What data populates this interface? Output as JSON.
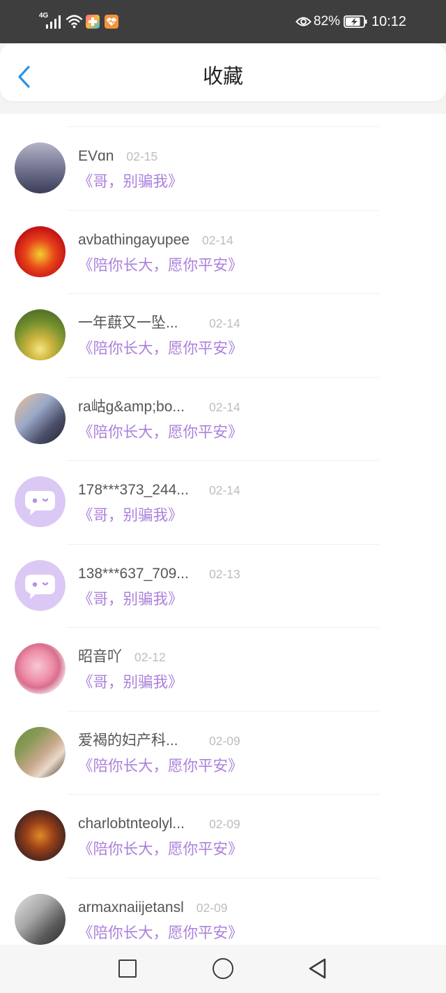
{
  "theme": {
    "status_bar_bg": "#3e3e3e",
    "accent": "#2a93e6",
    "subtitle_color": "#ab80dc",
    "name_color": "#555555",
    "date_color": "#bdbdbd"
  },
  "status_bar": {
    "network": "4G",
    "battery_label": "82%",
    "battery_level": 0.82,
    "time": "10:12",
    "icons": [
      "signal-icon",
      "wifi-icon",
      "app-badge-icon",
      "health-app-icon",
      "eye-comfort-icon",
      "battery-charging-icon"
    ]
  },
  "header": {
    "back_icon": "chevron-left-icon",
    "title": "收藏"
  },
  "favorites": [
    {
      "name": "EVɑn",
      "date": "02-15",
      "title": "《哥，别骗我》"
    },
    {
      "name": "avbathingayupee",
      "date": "02-14",
      "title": "《陪你长大，愿你平安》"
    },
    {
      "name": "一年蕻又一坠...",
      "date": "02-14",
      "title": "《陪你长大，愿你平安》"
    },
    {
      "name": "ra岵g&amp;bo...",
      "date": "02-14",
      "title": "《陪你长大，愿你平安》"
    },
    {
      "name": "178***373_244...",
      "date": "02-14",
      "title": "《哥，别骗我》",
      "avatar_icon": "default-avatar-icon"
    },
    {
      "name": "138***637_709...",
      "date": "02-13",
      "title": "《哥，别骗我》",
      "avatar_icon": "default-avatar-icon"
    },
    {
      "name": "昭音吖",
      "date": "02-12",
      "title": "《哥，别骗我》"
    },
    {
      "name": "爱褐的妇产科...",
      "date": "02-09",
      "title": "《陪你长大，愿你平安》"
    },
    {
      "name": "charlobtnteolyl...",
      "date": "02-09",
      "title": "《陪你长大，愿你平安》"
    },
    {
      "name": "armaxnaiijetansl",
      "date": "02-09",
      "title": "《陪你长大，愿你平安》"
    }
  ],
  "nav_bar": {
    "icons": [
      "recent-apps-icon",
      "home-icon",
      "back-icon"
    ]
  }
}
